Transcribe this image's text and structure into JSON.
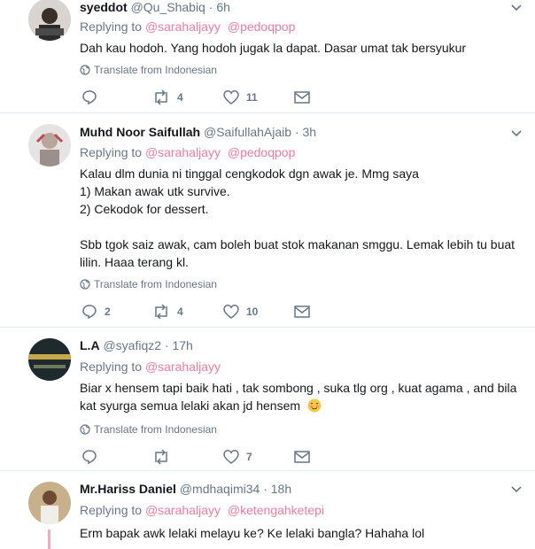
{
  "tweets": [
    {
      "name": "syeddot",
      "handle": "@Qu_Shabiq",
      "time": "6h",
      "replying_label": "Replying to",
      "mentions": [
        "@sarahaljayy",
        "@pedoqpop"
      ],
      "lines": [
        "Dah kau hodoh. Yang hodoh jugak la dapat. Dasar umat tak bersyukur"
      ],
      "translate": "Translate from Indonesian",
      "replies": "",
      "retweets": "4",
      "likes": "11"
    },
    {
      "name": "Muhd Noor Saifullah",
      "handle": "@SaifullahAjaib",
      "time": "3h",
      "replying_label": "Replying to",
      "mentions": [
        "@sarahaljayy",
        "@pedoqpop"
      ],
      "lines": [
        "Kalau dlm dunia ni tinggal cengkodok dgn awak je. Mmg saya",
        "1) Makan awak utk survive.",
        "2) Cekodok for dessert.",
        "",
        "Sbb tgok saiz awak, cam boleh buat stok makanan smggu. Lemak lebih tu buat",
        "lilin. Haaa terang kl."
      ],
      "translate": "Translate from Indonesian",
      "replies": "2",
      "retweets": "4",
      "likes": "10"
    },
    {
      "name": "L.A",
      "handle": "@syafiqz2",
      "time": "17h",
      "replying_label": "Replying to",
      "mentions": [
        "@sarahaljayy"
      ],
      "lines": [
        "Biar x hensem tapi baik hati , tak sombong , suka tlg org , kuat agama , and bila",
        "kat syurga semua lelaki akan jd hensem"
      ],
      "emoji": "smiling-face-emoji",
      "translate": "Translate from Indonesian",
      "replies": "",
      "retweets": "",
      "likes": "7"
    },
    {
      "name": "Mr.Hariss Daniel",
      "handle": "@mdhaqimi34",
      "time": "18h",
      "replying_label": "Replying to",
      "mentions": [
        "@sarahaljayy",
        "@ketengahketepi"
      ],
      "lines": [
        "Erm bapak awk lelaki melayu ke? Ke lelaki bangla? Hahaha lol"
      ]
    }
  ],
  "separator": "·",
  "colors": {
    "name": "#14171a",
    "meta": "#657786",
    "mention": "#e0245e",
    "divider": "#e6ecf0",
    "thread_line": "#f5a9c0"
  },
  "icons": [
    "chevron-down-icon",
    "reply-icon",
    "retweet-icon",
    "like-icon",
    "message-icon",
    "globe-icon"
  ]
}
